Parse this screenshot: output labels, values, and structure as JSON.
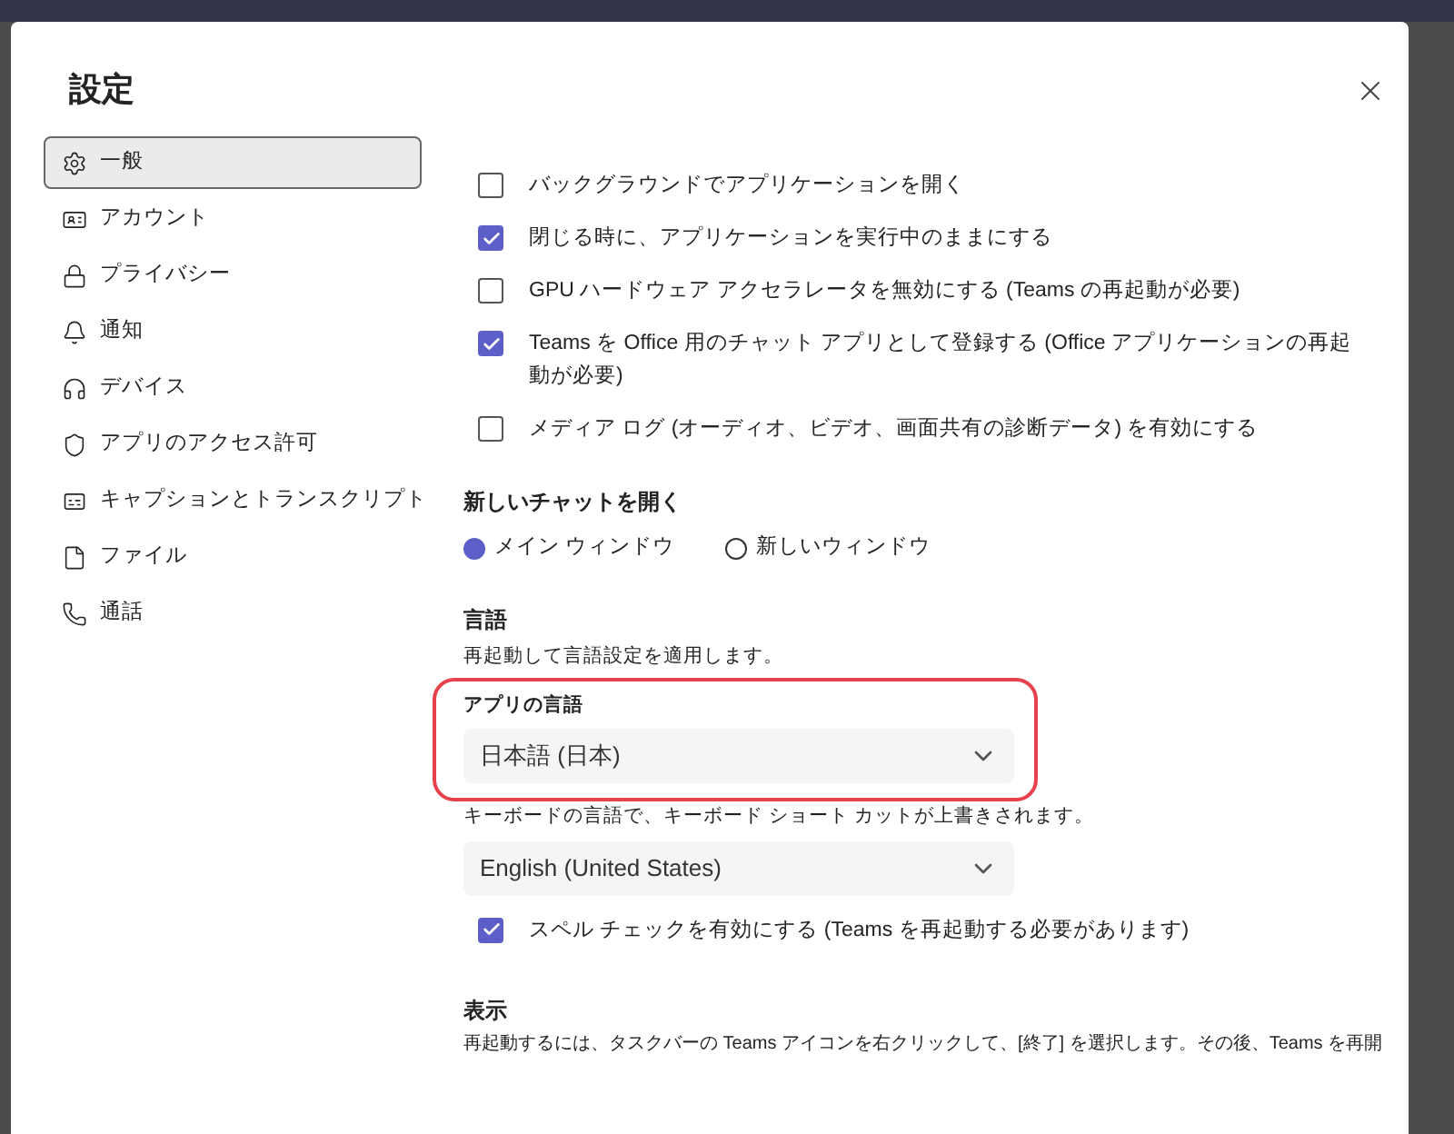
{
  "dialog": {
    "title": "設定"
  },
  "sidebar": {
    "items": [
      {
        "label": "一般",
        "selected": true
      },
      {
        "label": "アカウント",
        "selected": false
      },
      {
        "label": "プライバシー",
        "selected": false
      },
      {
        "label": "通知",
        "selected": false
      },
      {
        "label": "デバイス",
        "selected": false
      },
      {
        "label": "アプリのアクセス許可",
        "selected": false
      },
      {
        "label": "キャプションとトランスクリプト",
        "selected": false
      },
      {
        "label": "ファイル",
        "selected": false
      },
      {
        "label": "通話",
        "selected": false
      }
    ]
  },
  "options": [
    {
      "label": "バックグラウンドでアプリケーションを開く",
      "checked": false
    },
    {
      "label": "閉じる時に、アプリケーションを実行中のままにする",
      "checked": true
    },
    {
      "label": "GPU ハードウェア アクセラレータを無効にする (Teams の再起動が必要)",
      "checked": false
    },
    {
      "label": "Teams を Office 用のチャット アプリとして登録する (Office アプリケーションの再起動が必要)",
      "checked": true
    },
    {
      "label": "メディア ログ (オーディオ、ビデオ、画面共有の診断データ) を有効にする",
      "checked": false
    }
  ],
  "new_chat": {
    "heading": "新しいチャットを開く",
    "choices": [
      {
        "label": "メイン ウィンドウ",
        "selected": true
      },
      {
        "label": "新しいウィンドウ",
        "selected": false
      }
    ]
  },
  "language": {
    "heading": "言語",
    "subtitle": "再起動して言語設定を適用します。",
    "app_language_label": "アプリの言語",
    "app_language": "日本語 (日本)",
    "highlighted": true,
    "keyboard_hint": "キーボードの言語で、キーボード ショート カットが上書きされます。",
    "keyboard_language": "English (United States)",
    "spell_check": {
      "label": "スペル チェックを有効にする (Teams を再起動する必要があります)",
      "checked": true
    }
  },
  "display": {
    "heading": "表示",
    "text": "再起動するには、タスクバーの Teams アイコンを右クリックして、[終了] を選択します。その後、Teams を再開"
  }
}
